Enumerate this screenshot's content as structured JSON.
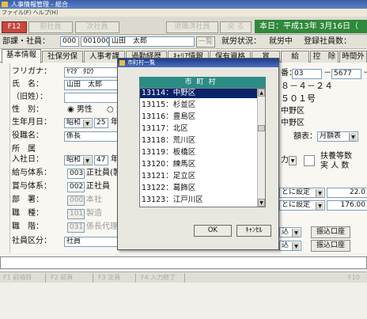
{
  "window": {
    "title": "人事情報管理 - 総合",
    "menu": "ファイル(F)  ヘルプ(H)"
  },
  "toolbar": {
    "buttons": [
      "F12",
      "前社員",
      "次社員",
      "退職済社員",
      "戻 る"
    ],
    "date": "本日：平成13年 3月16日（"
  },
  "employee_bar": {
    "label": "部課・社員：",
    "dept_code": "000",
    "emp_code": "001000",
    "name": "山田　太郎",
    "list_button": "一覧",
    "work_status_label": "就労状況：",
    "work_status": "就労中",
    "registered_label": "登録社員数："
  },
  "tabs": [
    "基本情報",
    "社保労保",
    "人事考課",
    "過勤経歴",
    "ｷｬﾘｱ情報",
    "保有資格",
    "賞",
    "給",
    "控　除",
    "時間外"
  ],
  "form": {
    "furigana_label": "フリガナ：",
    "furigana": "ﾔﾏﾀﾞ ﾀﾛｳ",
    "name_label": "氏　名：",
    "name": "山田　太郎",
    "maiden_label": "（旧姓）：",
    "gender_label": "性　別：",
    "gender_male": "男性",
    "gender_female": "女",
    "birth_label": "生年月日：",
    "birth_era": "昭和",
    "birth_year": "25",
    "birth_unit": "年",
    "title_label": "役職名：",
    "title": "係長",
    "belong_label": "所　属",
    "hire_label": "入社日：",
    "hire_era": "昭和",
    "hire_year": "47",
    "hire_unit": "年",
    "salary_label": "給与体系：",
    "salary_code": "003",
    "salary_name": "正社員(製",
    "bonus_label": "賞与体系：",
    "bonus_code": "002",
    "bonus_name": "正社員",
    "dept_label": "部　署：",
    "dept_code": "000",
    "dept_name": "本社",
    "job_label": "職　種：",
    "job_code": "101",
    "job_name": "製造",
    "grade_label": "職　階：",
    "grade_code": "031",
    "grade_name": "係長代理",
    "class_label": "社員区分：",
    "class": "社員",
    "phone_label": "番：",
    "phone_a": "03",
    "phone_b": "5677",
    "phone_c": "－",
    "addr1": "８－４－２４",
    "addr2": "５０１号",
    "ward1": "中野区",
    "ward2": "中野区",
    "amount_table_label": "額表：",
    "amount_table": "月額表",
    "deduct_mode": "力",
    "dependents_label": "扶養等数",
    "headcount_label": "実 人 数",
    "set1": "とに設定",
    "set1_value": "22.0",
    "set2": "とに設定",
    "set2_value": "176.00",
    "transfer_prefix": "込",
    "transfer_button": "振込口座",
    "transfer_prefix2": "込",
    "transfer_button2": "振込口座"
  },
  "dialog": {
    "title": "市町村一覧",
    "header": "市町村",
    "items": [
      "13114：中野区",
      "13115：杉並区",
      "13116：豊島区",
      "13117：北区",
      "13118：荒川区",
      "13119：板橋区",
      "13120：練馬区",
      "13121：足立区",
      "13122：葛飾区",
      "13123：江戸川区"
    ],
    "selected_index": 0,
    "ok_label": "OK",
    "cancel_label": "ｷｬﾝｾﾙ"
  },
  "fkeys": [
    "F1 前項目",
    "F2 前頁",
    "F3 次頁",
    "F4 入力終了",
    "F10"
  ],
  "colors": {
    "date_bg": "#2f8a3a",
    "list_header": "#2c8c86",
    "selection": "#0a246a",
    "f12": "#c8473f"
  }
}
